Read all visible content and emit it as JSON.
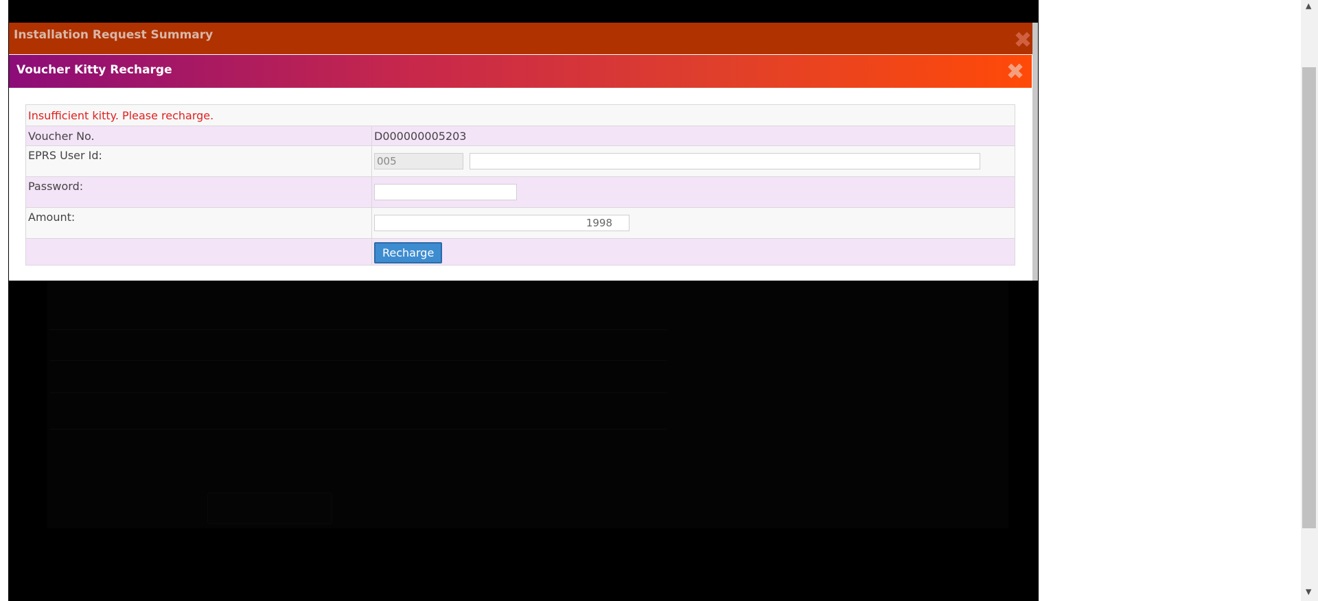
{
  "outer_dialog": {
    "title": "Installation Request Summary",
    "close_icon": "close-icon"
  },
  "recharge_dialog": {
    "title": "Voucher Kitty Recharge",
    "close_icon": "close-icon",
    "message": "Insufficient kitty. Please recharge.",
    "voucher": {
      "label": "Voucher No.",
      "value": "D000000005203"
    },
    "user_id": {
      "label": "EPRS User Id:",
      "prefix": "005",
      "value": ""
    },
    "password": {
      "label": "Password:",
      "value": ""
    },
    "amount": {
      "label": "Amount:",
      "value": "1998"
    },
    "recharge_label": "Recharge"
  },
  "colors": {
    "outer_title_bg": "#b03200",
    "inner_title_gradient_start": "#8c0c78",
    "inner_title_gradient_end": "#ff4a08",
    "error_text": "#e02020",
    "button_bg": "#3e8cd0",
    "row_pink": "#f4e4f8"
  },
  "scrollbar": {
    "up_icon": "scroll-up-arrow-icon",
    "down_icon": "scroll-down-arrow-icon"
  }
}
